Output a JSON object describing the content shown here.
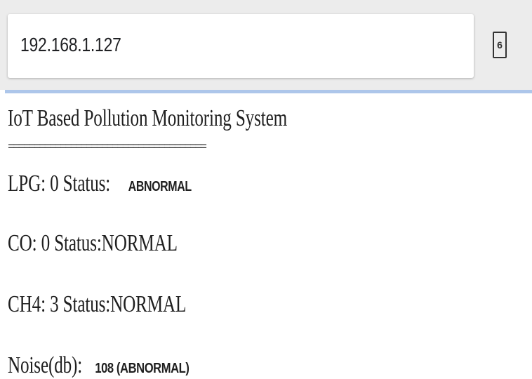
{
  "browser": {
    "url": "192.168.1.127",
    "tab_count": "6"
  },
  "page": {
    "title": "IoT Based Pollution Monitoring System",
    "separator": "======================================",
    "lpg": {
      "label": "LPG: 0 Status:",
      "status": "ABNORMAL"
    },
    "co": {
      "text": "CO: 0 Status:NORMAL"
    },
    "ch4": {
      "text": "CH4: 3 Status:NORMAL"
    },
    "noise": {
      "label": "Noise(db):",
      "value": "108 (ABNORMAL)"
    }
  }
}
